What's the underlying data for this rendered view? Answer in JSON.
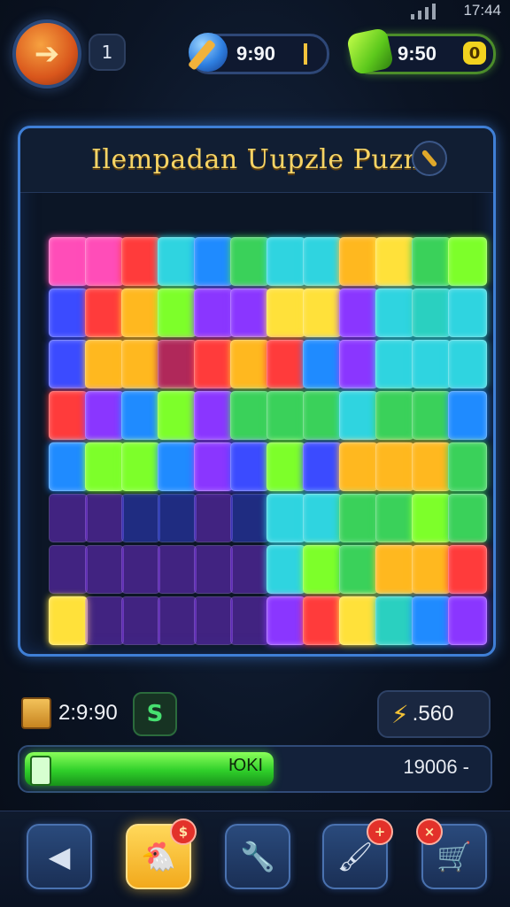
{
  "status_bar": {
    "time": "17:44"
  },
  "header": {
    "level": "1",
    "resource1": {
      "icon": "blue-orb-icon",
      "value": "9:90"
    },
    "resource2": {
      "icon": "green-gem-icon",
      "value": "9:50",
      "button": "0"
    }
  },
  "board": {
    "title": "Ilempadan Uupzle Puzn",
    "hint_icon": "key-icon",
    "colors": [
      "#ff4db8",
      "#ff3b3b",
      "#ffb81f",
      "#ffe13a",
      "#3ad15a",
      "#7dff2a",
      "#2fd4e0",
      "#1f8bff",
      "#3b4bff",
      "#8a36ff",
      "#b0285a",
      "#2ad0c0"
    ]
  },
  "stats": {
    "coins": "2:9:90",
    "s_button": "S",
    "energy": ".560"
  },
  "progress": {
    "percent": 0.54,
    "label": "ЮKI",
    "right_value": "19006 -"
  },
  "toolbar": {
    "items": [
      {
        "name": "back",
        "icon": "triangle-back-icon",
        "badge": ""
      },
      {
        "name": "character",
        "icon": "chicken-icon",
        "badge": "$"
      },
      {
        "name": "tool",
        "icon": "wrench-icon",
        "badge": ""
      },
      {
        "name": "paint",
        "icon": "brush-icon",
        "badge": "+"
      },
      {
        "name": "trolley",
        "icon": "cart-icon",
        "badge": "×"
      }
    ]
  }
}
